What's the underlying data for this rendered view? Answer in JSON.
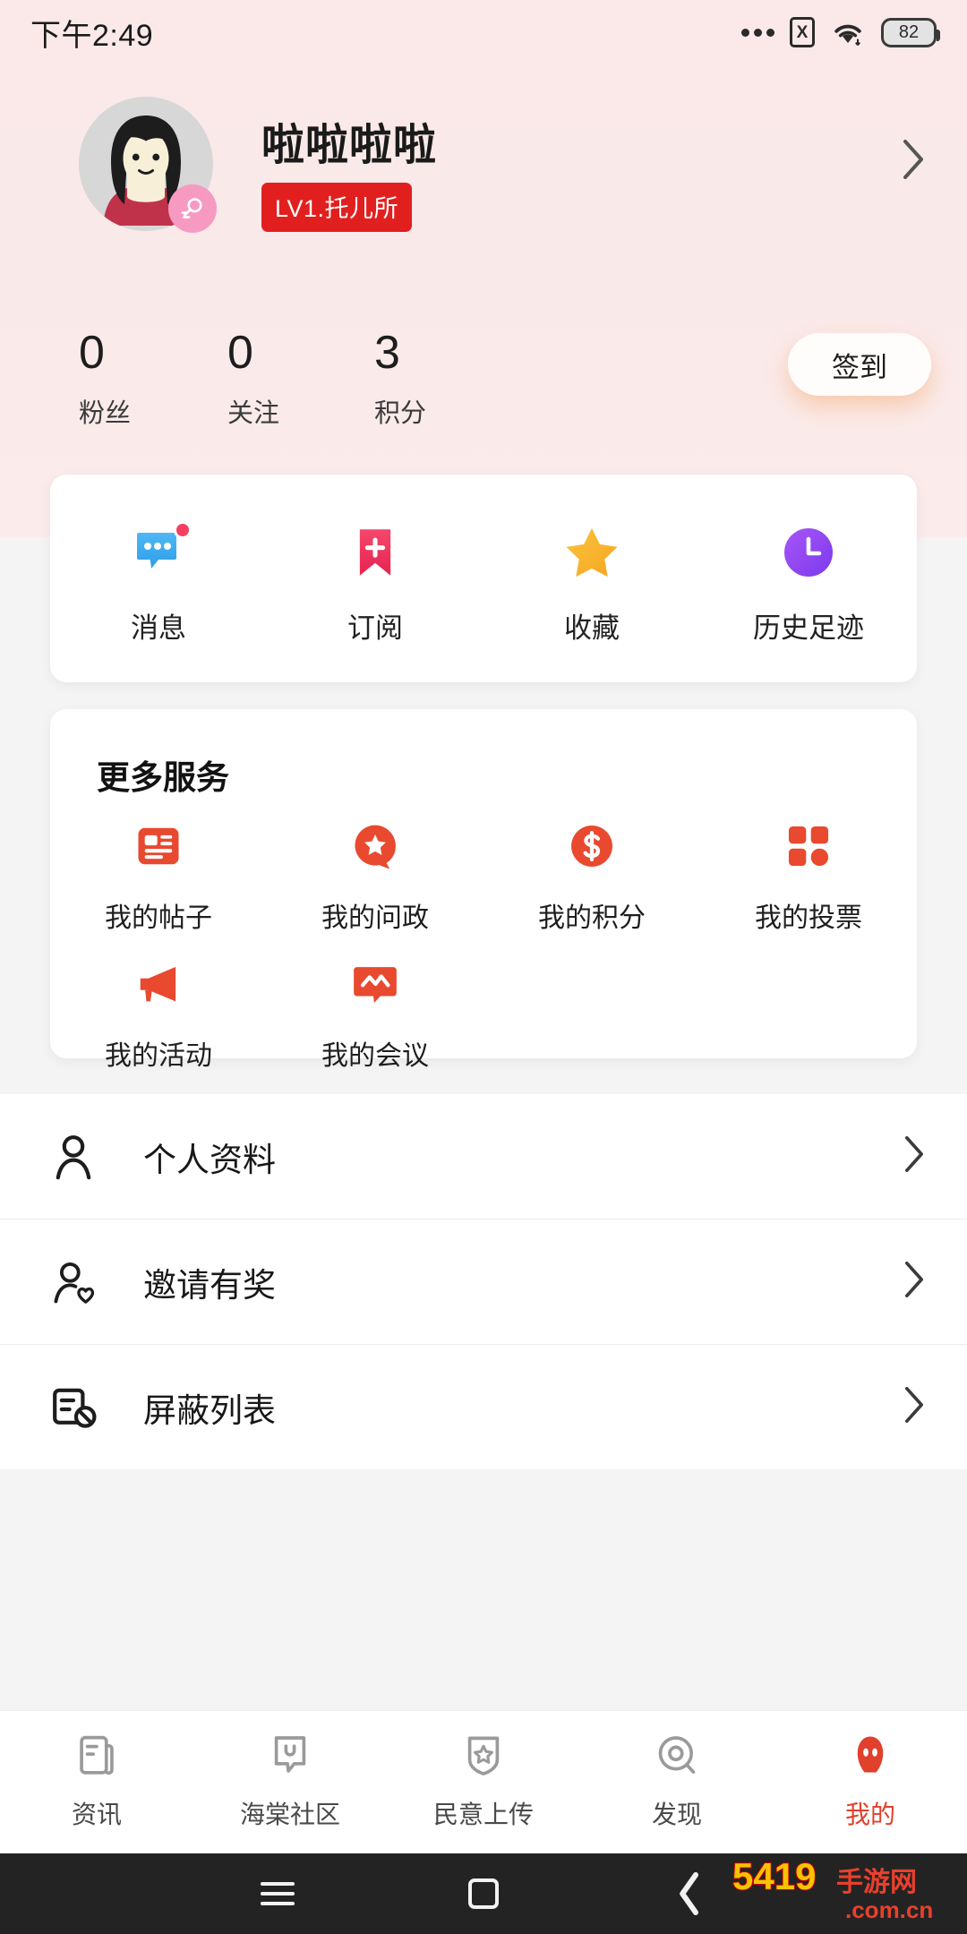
{
  "statusbar": {
    "time": "下午2:49",
    "dots_icon": "more-dots-icon",
    "sim_icon": "sim-card-disabled-icon",
    "sim_glyph": "X",
    "wifi_icon": "wifi-icon",
    "battery_icon": "battery-icon",
    "battery_level": "82"
  },
  "profile": {
    "avatar_icon": "avatar-female-illustration",
    "gender_badge_icon": "female-gender-icon",
    "username": "啦啦啦啦",
    "level_badge": "LV1.托儿所",
    "chevron_icon": "chevron-right-icon",
    "signin_label": "签到",
    "stats": [
      {
        "value": "0",
        "label": "粉丝"
      },
      {
        "value": "0",
        "label": "关注"
      },
      {
        "value": "3",
        "label": "积分"
      }
    ]
  },
  "quick_actions": [
    {
      "label": "消息",
      "icon": "chat-bubble-icon",
      "badge": true
    },
    {
      "label": "订阅",
      "icon": "bookmark-plus-icon",
      "badge": false
    },
    {
      "label": "收藏",
      "icon": "star-icon",
      "badge": false
    },
    {
      "label": "历史足迹",
      "icon": "clock-history-icon",
      "badge": false
    }
  ],
  "services": {
    "title": "更多服务",
    "items": [
      {
        "label": "我的帖子",
        "icon": "post-board-icon"
      },
      {
        "label": "我的问政",
        "icon": "star-badge-icon"
      },
      {
        "label": "我的积分",
        "icon": "dollar-coin-icon"
      },
      {
        "label": "我的投票",
        "icon": "grid-blocks-icon"
      },
      {
        "label": "我的活动",
        "icon": "megaphone-icon"
      },
      {
        "label": "我的会议",
        "icon": "meeting-screen-icon"
      }
    ]
  },
  "menu": [
    {
      "label": "个人资料",
      "icon": "person-icon",
      "chevron": "chevron-right-icon"
    },
    {
      "label": "邀请有奖",
      "icon": "person-heart-icon",
      "chevron": "chevron-right-icon"
    },
    {
      "label": "屏蔽列表",
      "icon": "block-list-icon",
      "chevron": "chevron-right-icon"
    }
  ],
  "bottomnav": [
    {
      "label": "资讯",
      "icon": "news-icon",
      "active": false
    },
    {
      "label": "海棠社区",
      "icon": "community-chat-icon",
      "active": false
    },
    {
      "label": "民意上传",
      "icon": "shield-star-icon",
      "active": false
    },
    {
      "label": "发现",
      "icon": "discover-icon",
      "active": false
    },
    {
      "label": "我的",
      "icon": "profile-person-icon",
      "active": true
    }
  ],
  "sysnav": {
    "menu_icon": "system-menu-icon",
    "home_icon": "system-home-icon",
    "back_icon": "system-back-icon"
  },
  "watermark": {
    "text": "5419",
    "sub1": "手游网",
    "sub2": ".com.cn"
  },
  "colors": {
    "header_bg": "#fae9e9",
    "accent_red": "#e0402c",
    "level_red": "#e21f1f",
    "pink": "#f79ac2",
    "page_bg": "#f4f4f4"
  }
}
